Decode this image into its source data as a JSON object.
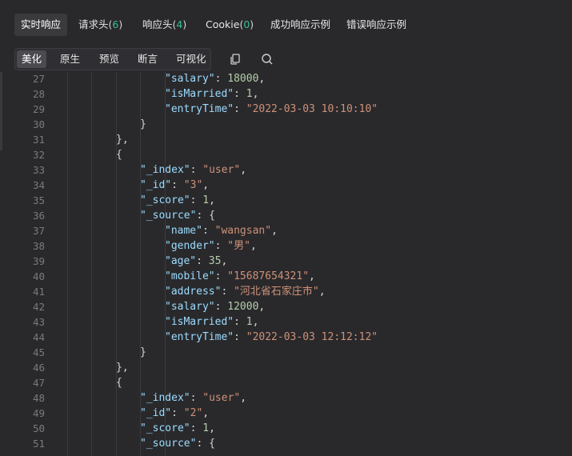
{
  "tabs": [
    {
      "label": "实时响应",
      "count": "",
      "active": true
    },
    {
      "label": "请求头",
      "count": "6",
      "active": false
    },
    {
      "label": "响应头",
      "count": "4",
      "active": false
    },
    {
      "label": "Cookie",
      "count": "0",
      "active": false
    },
    {
      "label": "成功响应示例",
      "count": "",
      "active": false
    },
    {
      "label": "错误响应示例",
      "count": "",
      "active": false
    }
  ],
  "view_modes": [
    "美化",
    "原生",
    "预览",
    "断言",
    "可视化"
  ],
  "active_view_mode": "美化",
  "tools": {
    "copy": "copy-icon",
    "search": "search-icon"
  },
  "code_lines": [
    {
      "n": "27",
      "indent": 4,
      "t": [
        [
          "k",
          "\"salary\""
        ],
        [
          "p",
          ": "
        ],
        [
          "n",
          "18000"
        ],
        [
          "p",
          ","
        ]
      ]
    },
    {
      "n": "28",
      "indent": 4,
      "t": [
        [
          "k",
          "\"isMarried\""
        ],
        [
          "p",
          ": "
        ],
        [
          "n",
          "1"
        ],
        [
          "p",
          ","
        ]
      ]
    },
    {
      "n": "29",
      "indent": 4,
      "t": [
        [
          "k",
          "\"entryTime\""
        ],
        [
          "p",
          ": "
        ],
        [
          "s",
          "\"2022-03-03 10:10:10\""
        ]
      ]
    },
    {
      "n": "30",
      "indent": 3,
      "t": [
        [
          "p",
          "}"
        ]
      ]
    },
    {
      "n": "31",
      "indent": 2,
      "t": [
        [
          "p",
          "},"
        ]
      ]
    },
    {
      "n": "32",
      "indent": 2,
      "t": [
        [
          "p",
          "{"
        ]
      ]
    },
    {
      "n": "33",
      "indent": 3,
      "t": [
        [
          "k",
          "\"_index\""
        ],
        [
          "p",
          ": "
        ],
        [
          "s",
          "\"user\""
        ],
        [
          "p",
          ","
        ]
      ]
    },
    {
      "n": "34",
      "indent": 3,
      "t": [
        [
          "k",
          "\"_id\""
        ],
        [
          "p",
          ": "
        ],
        [
          "s",
          "\"3\""
        ],
        [
          "p",
          ","
        ]
      ]
    },
    {
      "n": "35",
      "indent": 3,
      "t": [
        [
          "k",
          "\"_score\""
        ],
        [
          "p",
          ": "
        ],
        [
          "n",
          "1"
        ],
        [
          "p",
          ","
        ]
      ]
    },
    {
      "n": "36",
      "indent": 3,
      "t": [
        [
          "k",
          "\"_source\""
        ],
        [
          "p",
          ": {"
        ]
      ]
    },
    {
      "n": "37",
      "indent": 4,
      "t": [
        [
          "k",
          "\"name\""
        ],
        [
          "p",
          ": "
        ],
        [
          "s",
          "\"wangsan\""
        ],
        [
          "p",
          ","
        ]
      ]
    },
    {
      "n": "38",
      "indent": 4,
      "t": [
        [
          "k",
          "\"gender\""
        ],
        [
          "p",
          ": "
        ],
        [
          "s",
          "\"男\""
        ],
        [
          "p",
          ","
        ]
      ]
    },
    {
      "n": "39",
      "indent": 4,
      "t": [
        [
          "k",
          "\"age\""
        ],
        [
          "p",
          ": "
        ],
        [
          "n",
          "35"
        ],
        [
          "p",
          ","
        ]
      ]
    },
    {
      "n": "40",
      "indent": 4,
      "t": [
        [
          "k",
          "\"mobile\""
        ],
        [
          "p",
          ": "
        ],
        [
          "s",
          "\"15687654321\""
        ],
        [
          "p",
          ","
        ]
      ]
    },
    {
      "n": "41",
      "indent": 4,
      "t": [
        [
          "k",
          "\"address\""
        ],
        [
          "p",
          ": "
        ],
        [
          "s",
          "\"河北省石家庄市\""
        ],
        [
          "p",
          ","
        ]
      ]
    },
    {
      "n": "42",
      "indent": 4,
      "t": [
        [
          "k",
          "\"salary\""
        ],
        [
          "p",
          ": "
        ],
        [
          "n",
          "12000"
        ],
        [
          "p",
          ","
        ]
      ]
    },
    {
      "n": "43",
      "indent": 4,
      "t": [
        [
          "k",
          "\"isMarried\""
        ],
        [
          "p",
          ": "
        ],
        [
          "n",
          "1"
        ],
        [
          "p",
          ","
        ]
      ]
    },
    {
      "n": "44",
      "indent": 4,
      "t": [
        [
          "k",
          "\"entryTime\""
        ],
        [
          "p",
          ": "
        ],
        [
          "s",
          "\"2022-03-03 12:12:12\""
        ]
      ]
    },
    {
      "n": "45",
      "indent": 3,
      "t": [
        [
          "p",
          "}"
        ]
      ]
    },
    {
      "n": "46",
      "indent": 2,
      "t": [
        [
          "p",
          "},"
        ]
      ]
    },
    {
      "n": "47",
      "indent": 2,
      "t": [
        [
          "p",
          "{"
        ]
      ]
    },
    {
      "n": "48",
      "indent": 3,
      "t": [
        [
          "k",
          "\"_index\""
        ],
        [
          "p",
          ": "
        ],
        [
          "s",
          "\"user\""
        ],
        [
          "p",
          ","
        ]
      ]
    },
    {
      "n": "49",
      "indent": 3,
      "t": [
        [
          "k",
          "\"_id\""
        ],
        [
          "p",
          ": "
        ],
        [
          "s",
          "\"2\""
        ],
        [
          "p",
          ","
        ]
      ]
    },
    {
      "n": "50",
      "indent": 3,
      "t": [
        [
          "k",
          "\"_score\""
        ],
        [
          "p",
          ": "
        ],
        [
          "n",
          "1"
        ],
        [
          "p",
          ","
        ]
      ]
    },
    {
      "n": "51",
      "indent": 3,
      "t": [
        [
          "k",
          "\"_source\""
        ],
        [
          "p",
          ": {"
        ]
      ]
    }
  ]
}
